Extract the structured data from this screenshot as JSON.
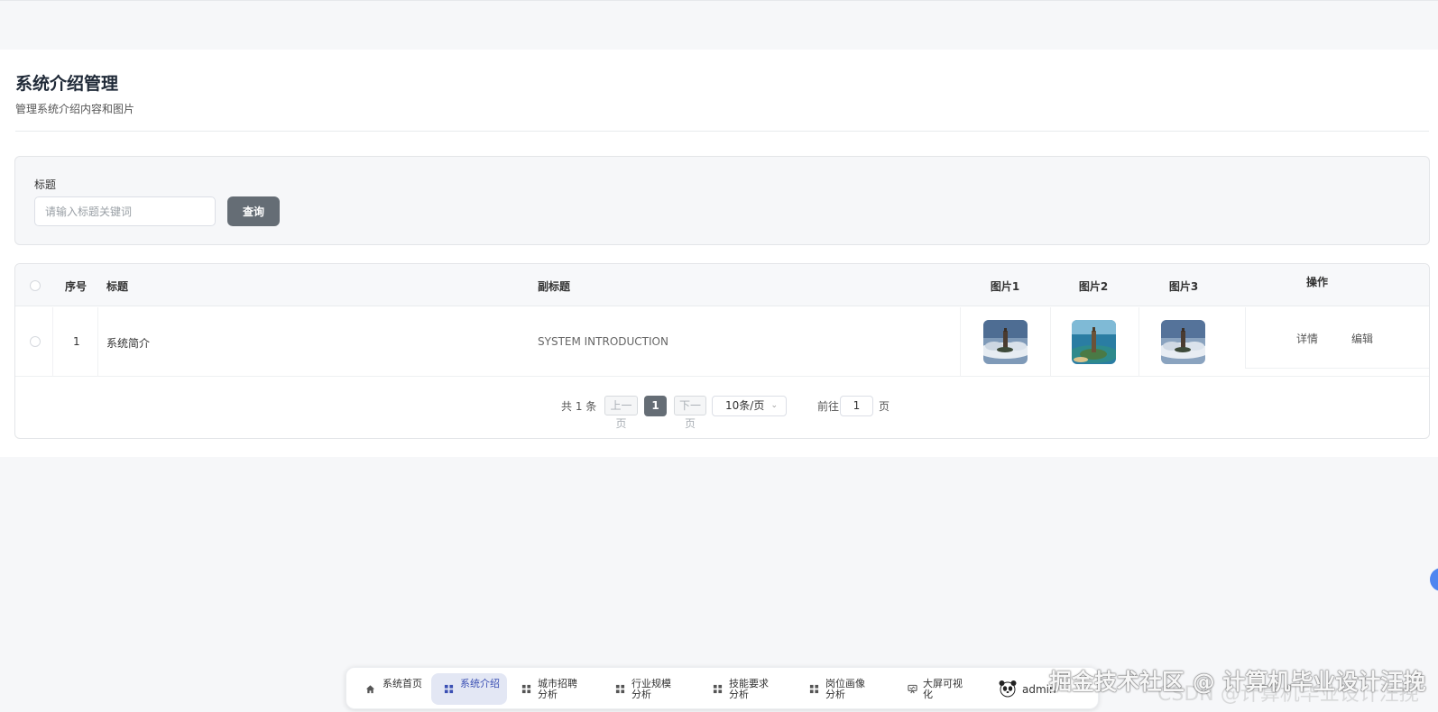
{
  "page": {
    "title": "系统介绍管理",
    "subtitle": "管理系统介绍内容和图片"
  },
  "search": {
    "label": "标题",
    "placeholder": "请输入标题关键词",
    "button": "查询"
  },
  "table": {
    "headers": {
      "index": "序号",
      "title": "标题",
      "subtitle": "副标题",
      "image1": "图片1",
      "image2": "图片2",
      "image3": "图片3",
      "actions": "操作"
    },
    "rows": [
      {
        "index": "1",
        "title": "系统简介",
        "subtitle": "SYSTEM INTRODUCTION",
        "detail": "详情",
        "edit": "编辑"
      }
    ]
  },
  "pagination": {
    "total": "共 1 条",
    "prev": "上一页",
    "current": "1",
    "next": "下一页",
    "page_size": "10条/页",
    "goto_prefix": "前往",
    "goto_value": "1",
    "goto_suffix": "页"
  },
  "dock": {
    "items": [
      {
        "label": "系统首页",
        "icon": "home-icon"
      },
      {
        "label": "系统介绍",
        "icon": "grid-icon",
        "active": true
      },
      {
        "label": "城市招聘分析",
        "icon": "grid-icon"
      },
      {
        "label": "行业规模分析",
        "icon": "grid-icon"
      },
      {
        "label": "技能要求分析",
        "icon": "grid-icon"
      },
      {
        "label": "岗位画像分析",
        "icon": "grid-icon"
      },
      {
        "label": "大屏可视化",
        "icon": "screen-icon"
      }
    ],
    "user": {
      "name": "admin",
      "avatar": "panda-avatar"
    }
  },
  "watermark": {
    "text": "掘金技术社区 @ 计算机毕业设计汪挽",
    "text_faint": "CSDN @计算机毕业设计汪挽"
  },
  "colors": {
    "primary_button": "#656d75",
    "active_nav_bg": "#e3e7f4",
    "active_nav_text": "#3a4fb3",
    "float_button": "#4f86f0"
  }
}
